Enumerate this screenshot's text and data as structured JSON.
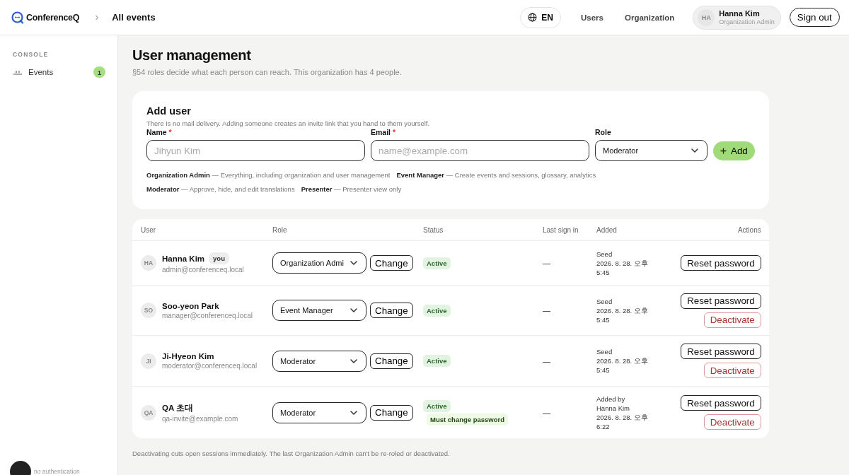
{
  "header": {
    "logo_text": "ConferenceQ",
    "breadcrumb": "All events",
    "language": "EN",
    "nav": [
      {
        "label": "Users"
      },
      {
        "label": "Organization"
      }
    ],
    "user": {
      "initials": "HA",
      "name": "Hanna Kim",
      "role": "Organization Admin"
    },
    "sign_out": "Sign out"
  },
  "sidebar": {
    "section": "CONSOLE",
    "items": [
      {
        "label": "Events",
        "count": "1",
        "selected": false
      }
    ],
    "footer_status": "no authentication"
  },
  "page": {
    "title": "User management",
    "subtitle": "§54 roles decide what each person can reach. This organization has 4 people."
  },
  "add_user": {
    "title": "Add user",
    "note": "There is no mail delivery. Adding someone creates an invite link that you hand to them yourself.",
    "fields": [
      {
        "kind": "text",
        "label": "Name",
        "required_mark": "*",
        "placeholder": "Jihyun Kim"
      },
      {
        "kind": "text",
        "label": "Email",
        "required_mark": "*",
        "placeholder": "name@example.com"
      },
      {
        "kind": "select",
        "label": "Role",
        "value": "Moderator"
      }
    ],
    "add_button": "Add",
    "roles": [
      {
        "name": "Organization Admin",
        "description": "— Everything, including organization and user management"
      },
      {
        "name": "Event Manager",
        "description": "— Create events and sessions, glossary, analytics"
      },
      {
        "name": "Moderator",
        "description": "— Approve, hide, and edit translations"
      },
      {
        "name": "Presenter",
        "description": "— Presenter view only"
      }
    ]
  },
  "table": {
    "columns": [
      "User",
      "Role",
      "Status",
      "Last sign in",
      "Added",
      "Actions"
    ],
    "rows": [
      {
        "initials": "HA",
        "name": "Hanna Kim",
        "badge": "you",
        "email": "admin@conferenceq.local",
        "role": "Organization Admi",
        "change": "Change",
        "statuses": [
          {
            "kind": "active",
            "label": "Active"
          }
        ],
        "last_sign_in": "—",
        "added": [
          "Seed",
          "2026. 8. 28. 오후",
          "5:45"
        ],
        "actions": [
          {
            "kind": "reset",
            "label": "Reset password"
          }
        ]
      },
      {
        "initials": "SO",
        "name": "Soo-yeon Park",
        "email": "manager@conferenceq.local",
        "role": "Event Manager",
        "change": "Change",
        "statuses": [
          {
            "kind": "active",
            "label": "Active"
          }
        ],
        "last_sign_in": "—",
        "added": [
          "Seed",
          "2026. 8. 28. 오후",
          "5:45"
        ],
        "actions": [
          {
            "kind": "reset",
            "label": "Reset password"
          },
          {
            "kind": "danger",
            "label": "Deactivate"
          }
        ]
      },
      {
        "initials": "JI",
        "name": "Ji-Hyeon Kim",
        "email": "moderator@conferenceq.local",
        "role": "Moderator",
        "change": "Change",
        "statuses": [
          {
            "kind": "active",
            "label": "Active"
          }
        ],
        "last_sign_in": "—",
        "added": [
          "Seed",
          "2026. 8. 28. 오후",
          "5:45"
        ],
        "actions": [
          {
            "kind": "reset",
            "label": "Reset password"
          },
          {
            "kind": "danger",
            "label": "Deactivate"
          }
        ]
      },
      {
        "initials": "QA",
        "name": "QA 초대",
        "email": "qa-invite@example.com",
        "role": "Moderator",
        "change": "Change",
        "statuses": [
          {
            "kind": "active",
            "label": "Active"
          },
          {
            "kind": "warning",
            "label": "Must change password"
          }
        ],
        "last_sign_in": "—",
        "added": [
          "Added by",
          "Hanna Kim",
          "2026. 8. 28. 오후",
          "6:22"
        ],
        "actions": [
          {
            "kind": "reset",
            "label": "Reset password"
          },
          {
            "kind": "danger",
            "label": "Deactivate"
          }
        ]
      }
    ]
  },
  "footnote": "Deactivating cuts open sessions immediately. The last Organization Admin can't be re-roled or deactivated."
}
